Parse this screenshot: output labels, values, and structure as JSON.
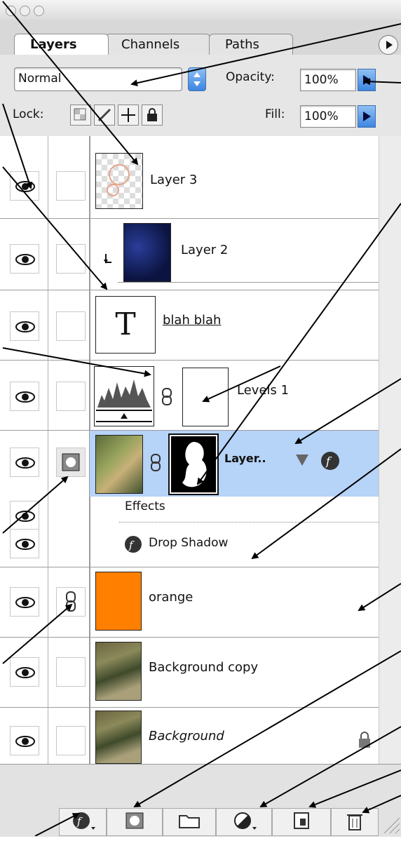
{
  "window": {
    "title_buttons": [
      "close",
      "minimize",
      "zoom"
    ]
  },
  "tabs": [
    {
      "label": "Layers",
      "active": true
    },
    {
      "label": "Channels",
      "active": false
    },
    {
      "label": "Paths",
      "active": false
    }
  ],
  "blend": {
    "mode": "Normal",
    "opacity_label": "Opacity:",
    "opacity_value": "100%"
  },
  "lock": {
    "label": "Lock:",
    "fill_label": "Fill:",
    "fill_value": "100%"
  },
  "layers": [
    {
      "name": "Layer 3",
      "visible": true,
      "thumbnail": "transparent-checker"
    },
    {
      "name": "Layer 2",
      "visible": true,
      "clipped": true,
      "thumbnail": "dark-blue-texture"
    },
    {
      "name": "blah blah",
      "visible": true,
      "type": "text",
      "thumb_glyph": "T"
    },
    {
      "name": "Levels 1",
      "visible": true,
      "type": "adjustment"
    },
    {
      "name": "Layer..",
      "visible": true,
      "selected": true,
      "has_mask": true
    },
    {
      "name": "orange",
      "visible": true,
      "linked": true
    },
    {
      "name": "Background copy",
      "visible": true
    },
    {
      "name": "Background",
      "visible": true,
      "locked": true
    }
  ],
  "effects": {
    "header": "Effects",
    "items": [
      "Drop Shadow"
    ]
  },
  "colors": {
    "selected_row": "#b6d3f8",
    "orange_fill": "#ff7f00",
    "accent_blue": "#3d86e1"
  },
  "bottom_tools": [
    "layer-style",
    "add-mask",
    "new-set",
    "new-adjustment-layer",
    "new-layer",
    "trash"
  ]
}
